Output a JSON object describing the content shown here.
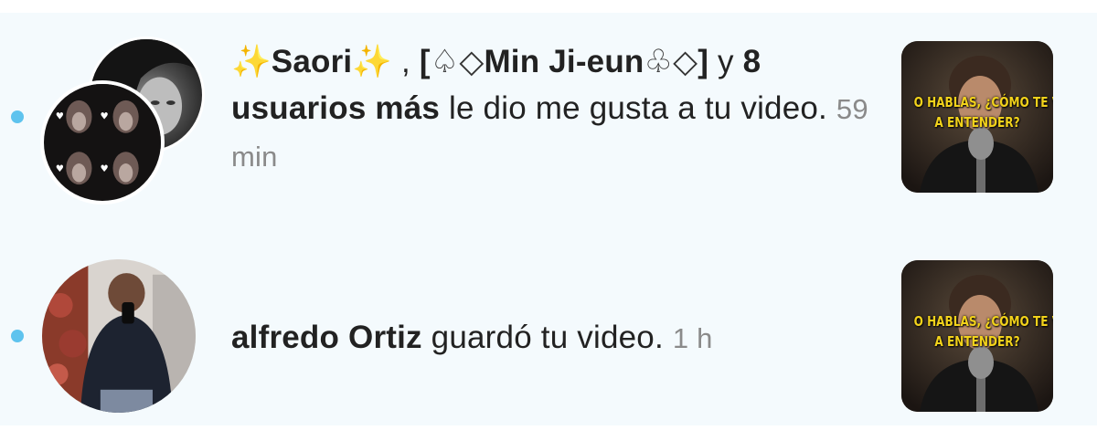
{
  "notifications": [
    {
      "actor1_prefix": "✨",
      "actor1_name": "Saori",
      "actor1_suffix": "✨",
      "separator": " , ",
      "actor2_open": "[",
      "actor2_suit1": "♤◇",
      "actor2_name": "Min Ji-eun",
      "actor2_suit2": "♧◇",
      "actor2_close": "]",
      "connector": " y ",
      "others": "8 usuarios más",
      "action": " le dio me gusta a tu video.",
      "time": "59 min",
      "unread": true,
      "thumbnail_caption_line1": "O HABLAS, ¿CÓMO TE VAN",
      "thumbnail_caption_line2": "A ENTENDER?"
    },
    {
      "actor_name": "alfredo Ortiz",
      "action": " guardó tu video.",
      "time": "1 h",
      "unread": true,
      "thumbnail_caption_line1": "O HABLAS, ¿CÓMO TE VAN",
      "thumbnail_caption_line2": "A ENTENDER?"
    }
  ],
  "colors": {
    "background": "#f4fafd",
    "unread_dot": "#5ec3ee",
    "text": "#222222",
    "time": "#8a8a8a",
    "caption": "#f2d21b"
  },
  "icons": {
    "unread_indicator": "dot"
  }
}
